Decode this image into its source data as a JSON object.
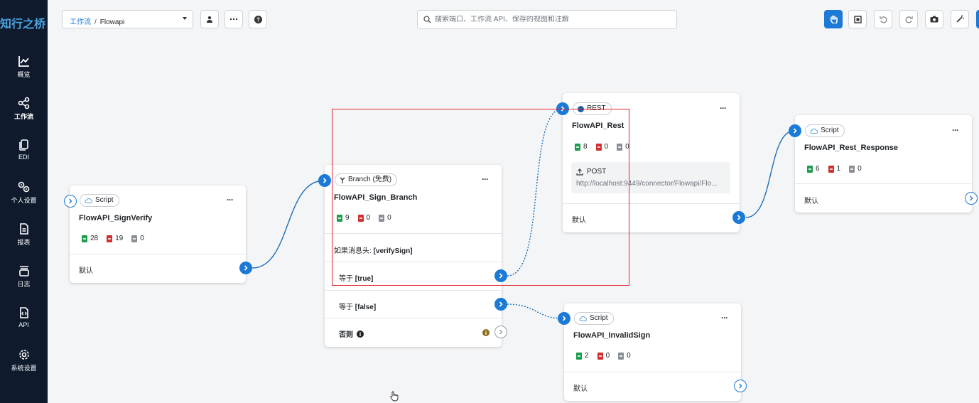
{
  "app": {
    "logo": "知行之桥"
  },
  "sidebar": {
    "items": [
      {
        "label": "概览",
        "icon": "chart-line-icon"
      },
      {
        "label": "工作流",
        "icon": "share-nodes-icon"
      },
      {
        "label": "EDI",
        "icon": "copy-icon"
      },
      {
        "label": "个人设置",
        "icon": "gears-icon"
      },
      {
        "label": "报表",
        "icon": "report-icon"
      },
      {
        "label": "日志",
        "icon": "log-icon"
      },
      {
        "label": "API",
        "icon": "api-file-icon"
      },
      {
        "label": "系统设置",
        "icon": "gear-icon"
      }
    ]
  },
  "breadcrumb": {
    "root": "工作流",
    "separator": "/",
    "current": "Flowapi"
  },
  "search": {
    "placeholder": "搜索端口、工作流 API、保存的视图和注解"
  },
  "colors": {
    "accent": "#1c7ad6",
    "sidebar": "#0f1b2d",
    "highlight": "#e0252b"
  },
  "nodes": {
    "signverify": {
      "type": "Script",
      "title": "FlowAPI_SignVerify",
      "counts": [
        "28",
        "19",
        "0"
      ],
      "route": "默认"
    },
    "branch": {
      "type": "Branch (免费)",
      "title": "FlowAPI_Sign_Branch",
      "counts": [
        "9",
        "0",
        "0"
      ],
      "condition_prefix": "如果消息头:",
      "condition_value": "[verifySign]",
      "case1_prefix": "等于",
      "case1_value": "[true]",
      "case2_prefix": "等于",
      "case2_value": "[false]",
      "else": "否则"
    },
    "rest": {
      "type": "REST",
      "title": "FlowAPI_Rest",
      "counts": [
        "8",
        "0",
        "0"
      ],
      "method": "POST",
      "url": "http://localhost:9449/connector/Flowapi/Flo...",
      "route": "默认"
    },
    "response": {
      "type": "Script",
      "title": "FlowAPI_Rest_Response",
      "counts": [
        "6",
        "1",
        "0"
      ],
      "route": "默认"
    },
    "invalid": {
      "type": "Script",
      "title": "FlowAPI_InvalidSign",
      "counts": [
        "2",
        "0",
        "0"
      ],
      "route": "默认"
    }
  }
}
